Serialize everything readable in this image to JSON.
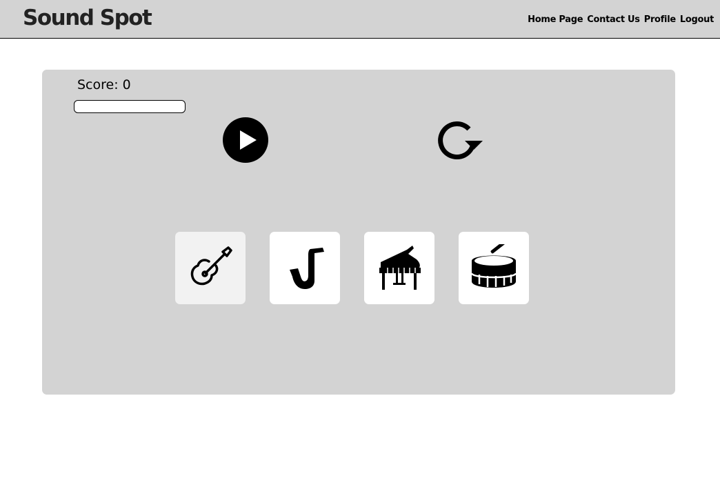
{
  "header": {
    "brand": "Sound Spot",
    "nav": [
      "Home Page",
      "Contact Us",
      "Profile",
      "Logout"
    ]
  },
  "game": {
    "score_label": "Score:",
    "score_value": "0",
    "progress": 0,
    "controls": {
      "play_icon": "play-icon",
      "restart_icon": "restart-icon"
    },
    "instruments": [
      {
        "name": "guitar",
        "icon": "guitar-icon",
        "selected": true
      },
      {
        "name": "saxophone",
        "icon": "saxophone-icon",
        "selected": false
      },
      {
        "name": "piano",
        "icon": "piano-icon",
        "selected": false
      },
      {
        "name": "drum",
        "icon": "drum-icon",
        "selected": false
      }
    ]
  },
  "colors": {
    "header_bg": "#d3d3d3",
    "panel_bg": "#d3d3d3",
    "tile_bg": "#ffffff",
    "tile_selected_bg": "#f2f2f2",
    "icon": "#000000"
  }
}
